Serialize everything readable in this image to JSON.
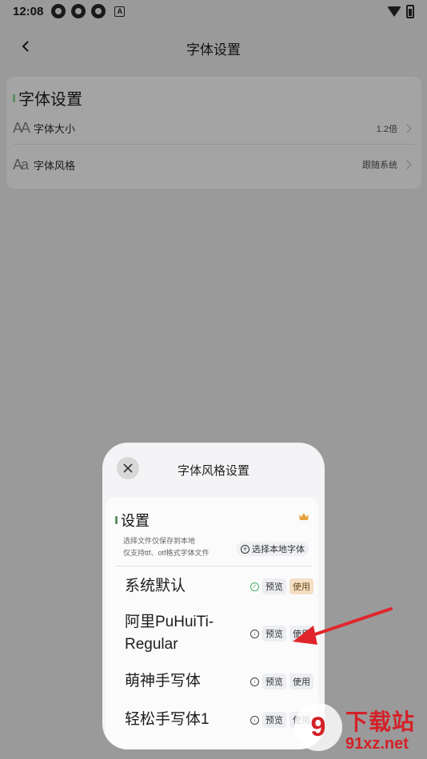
{
  "status_bar": {
    "time": "12:08",
    "badge": "A"
  },
  "header": {
    "title": "字体设置"
  },
  "settings": {
    "heading": "字体设置",
    "rows": [
      {
        "icon": "AA",
        "label": "字体大小",
        "value": "1.2倍"
      },
      {
        "icon": "Aa",
        "label": "字体风格",
        "value": "跟随系统"
      }
    ]
  },
  "sheet": {
    "title": "字体风格设置",
    "heading": "设置",
    "note_1": "选择文件仅保存到本地",
    "note_2": "仅支持ttf、otf格式字体文件",
    "select_local": "选择本地字体",
    "fonts": [
      {
        "name": "系统默认",
        "preview": "预览",
        "use": "使用"
      },
      {
        "name": "阿里PuHuiTi-Regular",
        "preview": "预览",
        "use": "使用"
      },
      {
        "name": "萌神手写体",
        "preview": "预览",
        "use": "使用"
      },
      {
        "name": "轻松手写体1",
        "preview": "预览",
        "use": "使用"
      }
    ]
  },
  "watermark": {
    "brand": "下载站",
    "logo": "9",
    "url": "91xz.net"
  },
  "colors": {
    "accent": "#5f8f63",
    "active_chip": "#f4dfc4",
    "watermark": "#d42128",
    "arrow": "#e0262b"
  }
}
